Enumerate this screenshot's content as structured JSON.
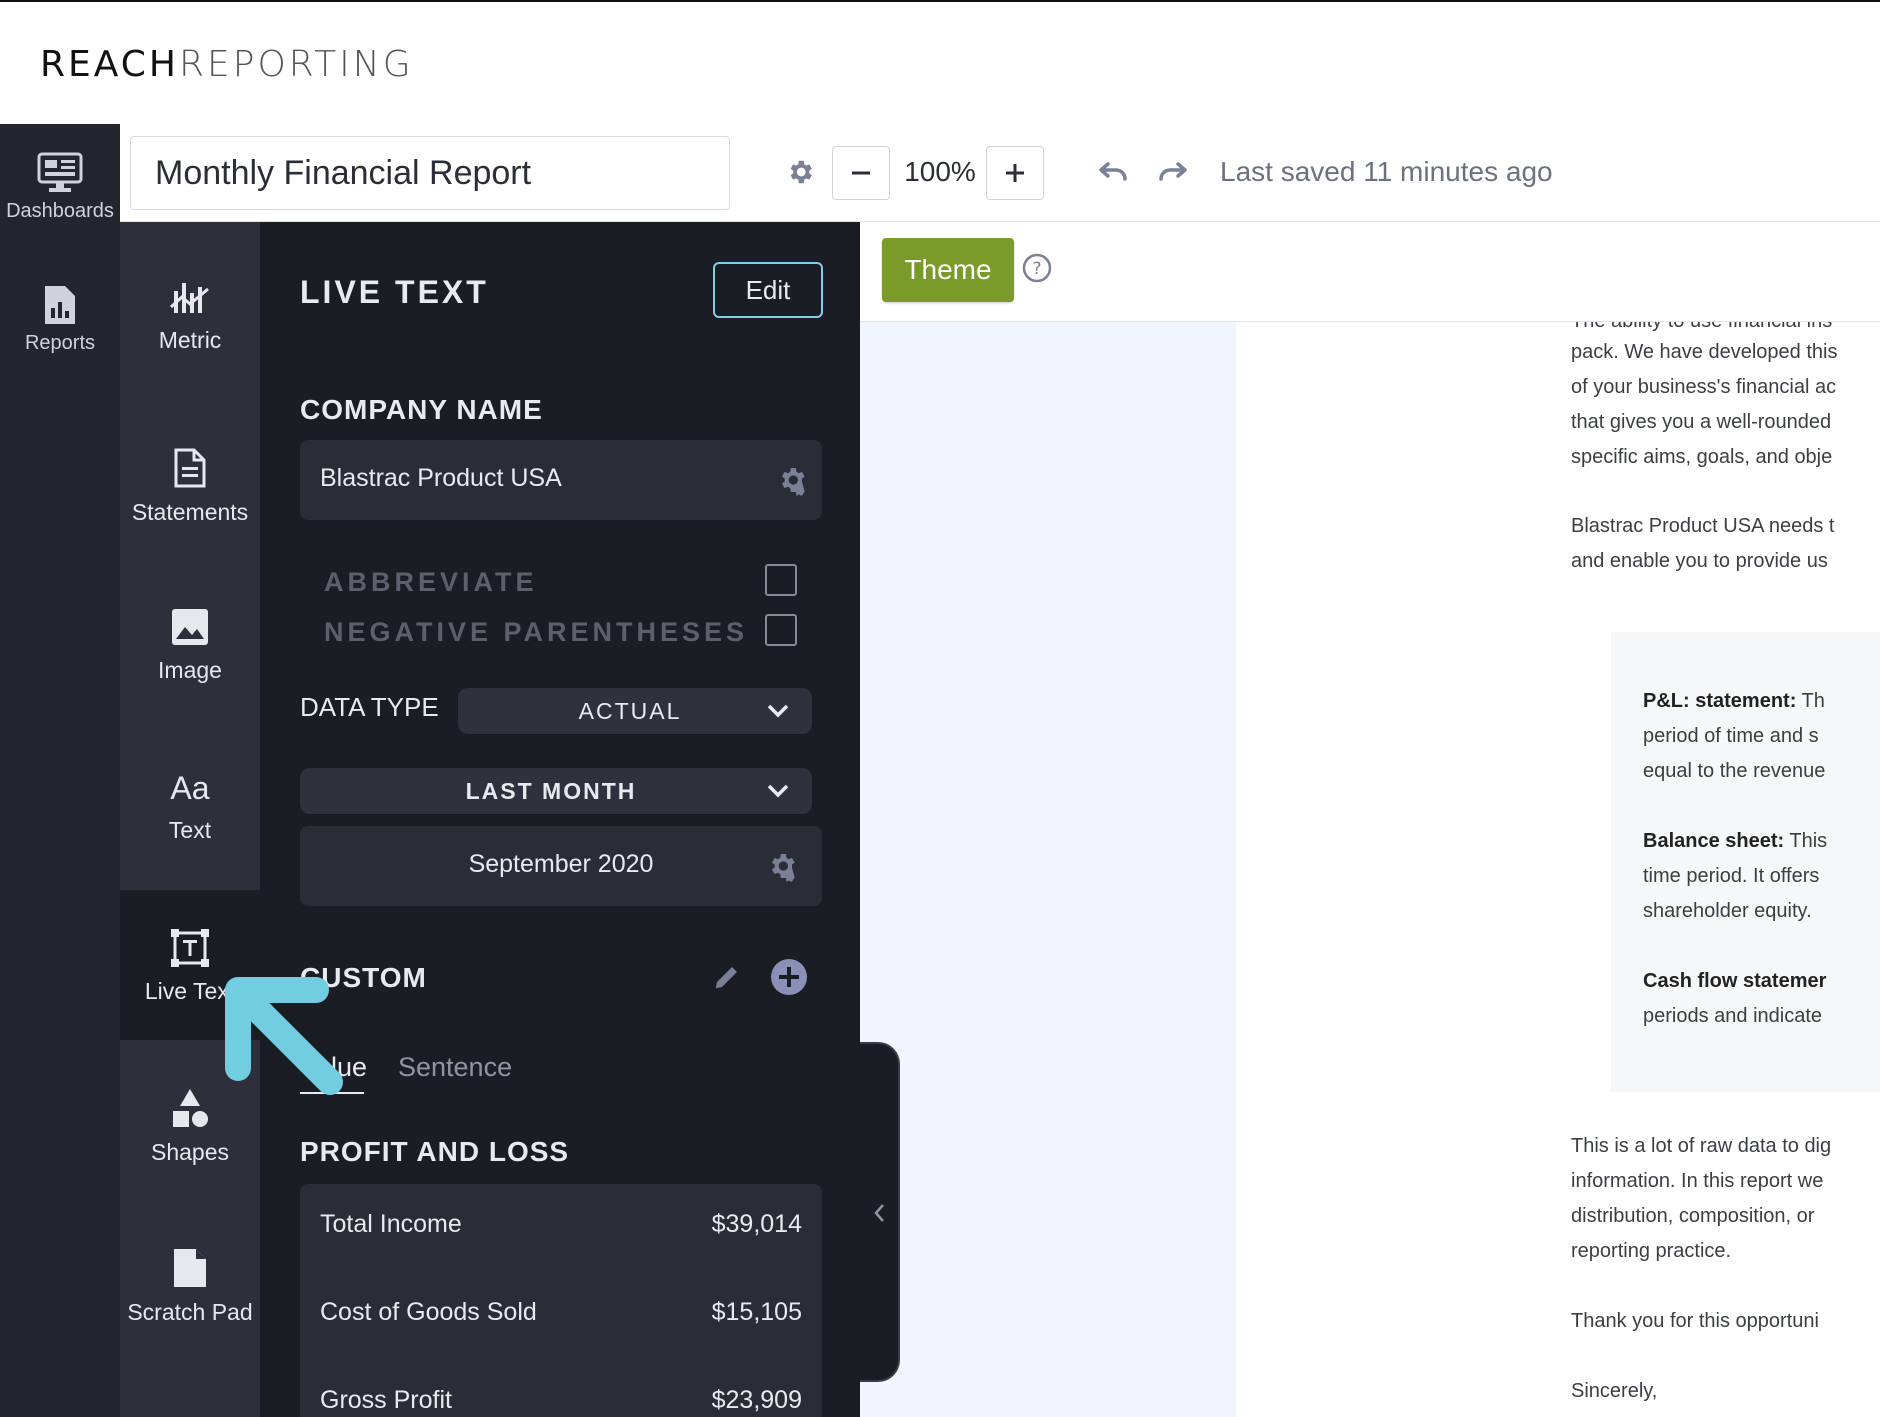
{
  "brand": {
    "part1": "REACH",
    "part2": "REPORTING"
  },
  "rail": {
    "items": [
      {
        "label": "Dashboards"
      },
      {
        "label": "Reports"
      }
    ]
  },
  "toolbar": {
    "title": "Monthly Financial Report",
    "zoom": "100%",
    "saved_text": "Last saved 11 minutes ago"
  },
  "tools": [
    {
      "label": "Metric"
    },
    {
      "label": "Statements"
    },
    {
      "label": "Image"
    },
    {
      "label": "Text",
      "glyph": "Aa"
    },
    {
      "label": "Live Text"
    },
    {
      "label": "Shapes"
    },
    {
      "label": "Scratch Pad"
    }
  ],
  "panel": {
    "title": "LIVE TEXT",
    "edit_label": "Edit",
    "company_header": "COMPANY NAME",
    "company_name": "Blastrac Product USA",
    "abbreviate": "ABBREVIATE",
    "negative_parentheses": "NEGATIVE PARENTHESES",
    "data_type_label": "DATA TYPE",
    "data_type_value": "ACTUAL",
    "period_value": "LAST MONTH",
    "date_value": "September 2020",
    "custom_header": "CUSTOM",
    "tabs": [
      {
        "label": "Value"
      },
      {
        "label": "Sentence"
      }
    ],
    "pl_header": "PROFIT AND LOSS",
    "pl_rows": [
      {
        "label": "Total Income",
        "value": "$39,014"
      },
      {
        "label": "Cost of Goods Sold",
        "value": "$15,105"
      },
      {
        "label": "Gross Profit",
        "value": "$23,909"
      }
    ]
  },
  "canvas": {
    "theme_label": "Theme",
    "doc_lines": [
      "The ability to use financial ins",
      "pack. We have developed this",
      "of your business's financial ac",
      "that gives you a well-rounded",
      "specific aims, goals, and obje",
      "Blastrac Product USA needs t",
      "and enable you to provide us",
      "This is a lot of raw data to dig",
      "information. In this report we",
      "distribution,  composition, or",
      "reporting practice.",
      "Thank you for this opportuni",
      "Sincerely,"
    ],
    "box_lines": [
      {
        "bold": "P&L: statement:",
        "rest": "  Th"
      },
      {
        "bold": "",
        "rest": "period of time and s"
      },
      {
        "bold": "",
        "rest": "equal to the revenue"
      },
      {
        "bold": "Balance sheet:",
        "rest": "  This"
      },
      {
        "bold": "",
        "rest": "time period. It offers"
      },
      {
        "bold": "",
        "rest": "shareholder equity."
      },
      {
        "bold": "Cash flow statemer",
        "rest": ""
      },
      {
        "bold": "",
        "rest": "periods and indicate"
      }
    ]
  },
  "colors": {
    "accent": "#7fd0e4",
    "theme": "#7a9a2a",
    "panel": "#1b1d24",
    "arrow": "#72cde0"
  }
}
